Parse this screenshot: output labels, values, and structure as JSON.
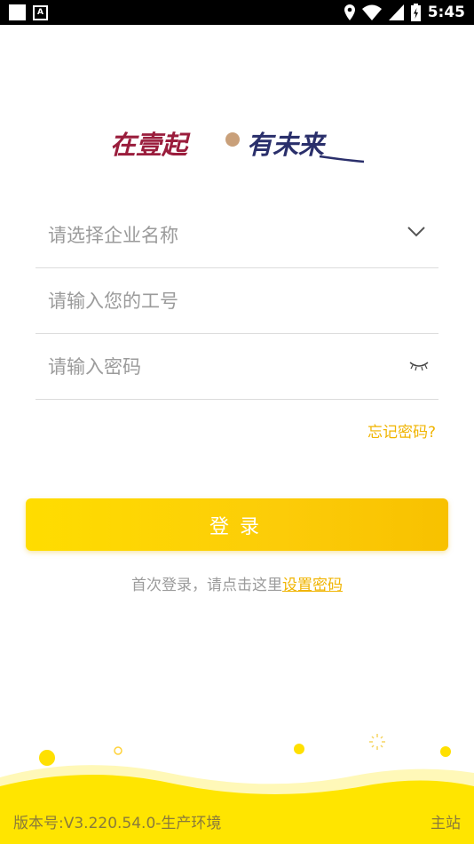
{
  "status_bar": {
    "time": "5:45",
    "icons": [
      "notification-square-icon",
      "accessibility-a-icon",
      "location-icon",
      "wifi-icon",
      "cellular-signal-icon",
      "battery-charging-icon"
    ]
  },
  "logo": {
    "slogan": "在壹起 有未来",
    "colors": {
      "primary": "#9a1d3c",
      "secondary": "#2a2f6b"
    }
  },
  "form": {
    "company": {
      "placeholder": "请选择企业名称",
      "icon": "chevron-down-icon"
    },
    "employee_id": {
      "placeholder": "请输入您的工号"
    },
    "password": {
      "placeholder": "请输入密码",
      "icon": "eye-closed-icon"
    },
    "forgot_password": "忘记密码?"
  },
  "login_button": {
    "label": "登录"
  },
  "first_login": {
    "text": "首次登录，请点击这里",
    "link": "设置密码"
  },
  "footer": {
    "version": "版本号:V3.220.54.0-生产环境",
    "main_site": "主站"
  },
  "colors": {
    "accent": "#f0b400",
    "button_start": "#ffdd00",
    "button_end": "#f8c100",
    "wave": "#ffe500"
  }
}
